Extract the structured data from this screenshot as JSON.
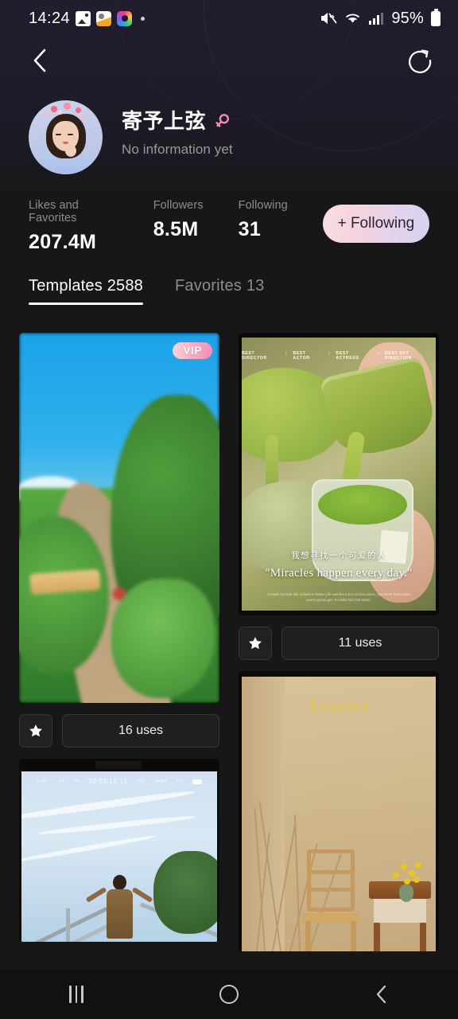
{
  "status_bar": {
    "time": "14:24",
    "icons": [
      "gallery-icon",
      "app-icon",
      "camera-icon",
      "dot-indicator"
    ],
    "mute_icon": "mute-icon",
    "wifi_icon": "wifi-icon",
    "signal_icon": "signal-icon",
    "battery_percent": "95%"
  },
  "nav": {
    "back_icon": "back-chevron-icon",
    "share_icon": "share-icon"
  },
  "profile": {
    "avatar": "user-avatar",
    "username": "寄予上弦",
    "gender_icon": "female-gender-icon",
    "gender_color": "#f48fb1",
    "description": "No information yet"
  },
  "stats": [
    {
      "label": "Likes and Favorites",
      "value": "207.4M"
    },
    {
      "label": "Followers",
      "value": "8.5M"
    },
    {
      "label": "Following",
      "value": "31"
    }
  ],
  "follow_button": {
    "label": "+ Following",
    "gradient_from": "#fbdfe4",
    "gradient_to": "#d5d2f0",
    "text_color": "#2b2330"
  },
  "tabs": [
    {
      "label": "Templates 2588",
      "active": true
    },
    {
      "label": "Favorites 13",
      "active": false
    }
  ],
  "grid": {
    "left_column": [
      {
        "artwork": "garden-path-photo",
        "badge": "VIP",
        "favorite_icon": "star-icon",
        "uses_label": "16 uses"
      },
      {
        "artwork": "sky-person-photo",
        "viewfinder": {
          "timecode": "00:03:19:15",
          "labels": [
            "STBY",
            "1/8",
            "F4",
            "ISO",
            "24MM",
            "3:2"
          ]
        }
      }
    ],
    "right_column": [
      {
        "artwork": "matcha-pour-photo",
        "overlay_awards": [
          "BEST DIRECTOR",
          "BEST ACTOR",
          "BEST ACTRESS",
          "BEST ART DIRECTION"
        ],
        "overlay_cn": "我想寻找一个可爱的人",
        "overlay_en": "\"Miracles happen every day.\"",
        "overlay_sub": "It made me look like a black-it matter\nLife was like a box of chocolates, you never know what you're gonna get.\nTo make him feel better.",
        "favorite_icon": "star-icon",
        "uses_label": "11 uses"
      },
      {
        "artwork": "autumn-chair-photo",
        "title": "Autumn"
      }
    ]
  },
  "android_nav": {
    "recents_icon": "recents-icon",
    "home_icon": "home-icon",
    "back_icon": "back-icon"
  }
}
